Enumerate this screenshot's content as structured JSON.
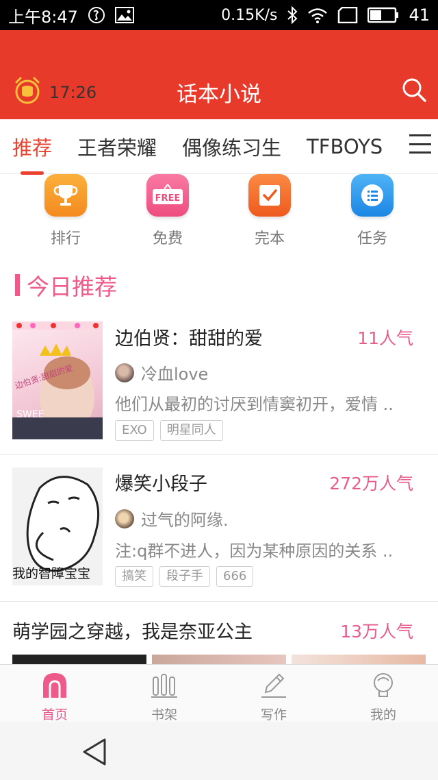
{
  "status_bar": {
    "time": "上午8:47",
    "network_speed": "0.15K/s",
    "battery": "41",
    "icons": [
      "notification-icon",
      "image-icon",
      "bluetooth-icon",
      "wifi-icon",
      "sim-icon",
      "battery-icon"
    ]
  },
  "header": {
    "clock_time": "17:26",
    "title": "话本小说",
    "icons": [
      "alarm-clock-icon",
      "search-icon"
    ]
  },
  "category_tabs": {
    "items": [
      "推荐",
      "王者荣耀",
      "偶像练习生",
      "TFBOYS"
    ],
    "active_index": 0,
    "menu_icon": "menu-icon"
  },
  "quick_entries": [
    {
      "label": "排行",
      "icon": "trophy-icon",
      "color": "#f7a02c"
    },
    {
      "label": "免费",
      "icon": "free-tag-icon",
      "color": "#f4628f",
      "icon_text": "FREE"
    },
    {
      "label": "完本",
      "icon": "check-note-icon",
      "color": "#f26a2e"
    },
    {
      "label": "任务",
      "icon": "task-list-icon",
      "color": "#2b95ea"
    }
  ],
  "section": {
    "title": "今日推荐"
  },
  "books": [
    {
      "title": "边伯贤：甜甜的爱",
      "popularity": "11人气",
      "author": "冷血love",
      "description": "他们从最初的讨厌到情窦初开，爱情 ..",
      "tags": [
        "EXO",
        "明星同人"
      ],
      "cover_text": "边伯贤:甜甜的爱",
      "cover_sub": "SWEE"
    },
    {
      "title": "爆笑小段子",
      "popularity": "272万人气",
      "author": "过气的阿缘.",
      "description": "注:q群不进人，因为某种原因的关系 ..",
      "tags": [
        "搞笑",
        "段子手",
        "666"
      ],
      "cover_text": "我的智障宝宝"
    },
    {
      "title": "萌学园之穿越，我是奈亚公主",
      "popularity": "13万人气"
    }
  ],
  "bottom_nav": [
    {
      "label": "首页",
      "icon": "home-icon"
    },
    {
      "label": "书架",
      "icon": "bookshelf-icon"
    },
    {
      "label": "写作",
      "icon": "pen-icon"
    },
    {
      "label": "我的",
      "icon": "profile-icon"
    }
  ],
  "bottom_nav_active": 0,
  "system_nav": {
    "icon": "back-triangle-icon"
  },
  "colors": {
    "header_red": "#e83a2a",
    "accent_pink": "#e85b8d",
    "tab_red": "#e8412e"
  }
}
